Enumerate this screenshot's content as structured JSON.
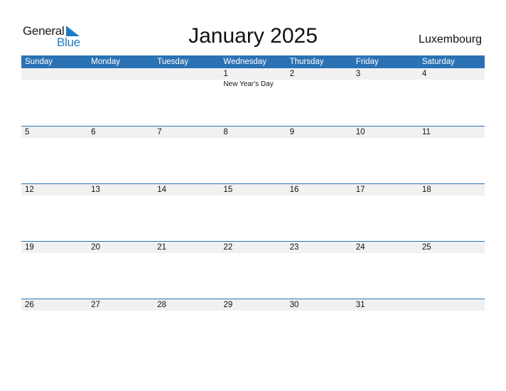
{
  "logo": {
    "line1": "General",
    "line2": "Blue"
  },
  "title": "January 2025",
  "country": "Luxembourg",
  "colors": {
    "header_bg": "#2b72b4",
    "logo_blue": "#1f7bc4",
    "date_strip": "#f1f1f1"
  },
  "weekdays": [
    "Sunday",
    "Monday",
    "Tuesday",
    "Wednesday",
    "Thursday",
    "Friday",
    "Saturday"
  ],
  "weeks": [
    [
      {
        "d": ""
      },
      {
        "d": ""
      },
      {
        "d": ""
      },
      {
        "d": "1",
        "h": "New Year's Day"
      },
      {
        "d": "2"
      },
      {
        "d": "3"
      },
      {
        "d": "4"
      }
    ],
    [
      {
        "d": "5"
      },
      {
        "d": "6"
      },
      {
        "d": "7"
      },
      {
        "d": "8"
      },
      {
        "d": "9"
      },
      {
        "d": "10"
      },
      {
        "d": "11"
      }
    ],
    [
      {
        "d": "12"
      },
      {
        "d": "13"
      },
      {
        "d": "14"
      },
      {
        "d": "15"
      },
      {
        "d": "16"
      },
      {
        "d": "17"
      },
      {
        "d": "18"
      }
    ],
    [
      {
        "d": "19"
      },
      {
        "d": "20"
      },
      {
        "d": "21"
      },
      {
        "d": "22"
      },
      {
        "d": "23"
      },
      {
        "d": "24"
      },
      {
        "d": "25"
      }
    ],
    [
      {
        "d": "26"
      },
      {
        "d": "27"
      },
      {
        "d": "28"
      },
      {
        "d": "29"
      },
      {
        "d": "30"
      },
      {
        "d": "31"
      },
      {
        "d": ""
      }
    ]
  ]
}
